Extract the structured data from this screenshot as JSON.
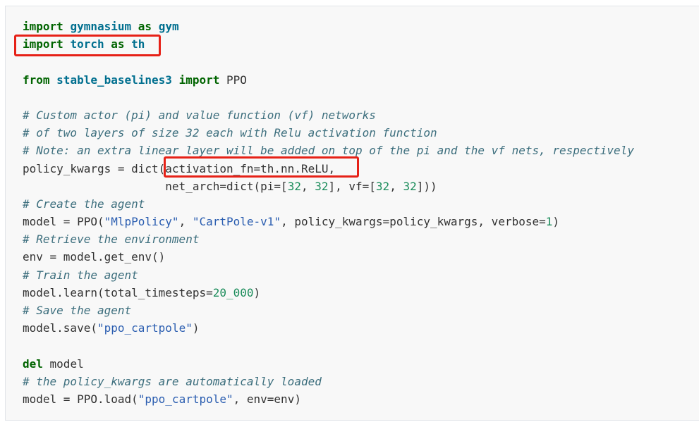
{
  "lines": [
    [
      {
        "t": "import",
        "c": "kw"
      },
      {
        "t": " "
      },
      {
        "t": "gymnasium",
        "c": "mod"
      },
      {
        "t": " "
      },
      {
        "t": "as",
        "c": "kw"
      },
      {
        "t": " "
      },
      {
        "t": "gym",
        "c": "mod"
      }
    ],
    [
      {
        "t": "import",
        "c": "kw"
      },
      {
        "t": " "
      },
      {
        "t": "torch",
        "c": "mod"
      },
      {
        "t": " "
      },
      {
        "t": "as",
        "c": "kw"
      },
      {
        "t": " "
      },
      {
        "t": "th",
        "c": "mod"
      }
    ],
    [],
    [
      {
        "t": "from",
        "c": "kw"
      },
      {
        "t": " "
      },
      {
        "t": "stable_baselines3",
        "c": "mod"
      },
      {
        "t": " "
      },
      {
        "t": "import",
        "c": "kw"
      },
      {
        "t": " PPO"
      }
    ],
    [],
    [
      {
        "t": "# Custom actor (pi) and value function (vf) networks",
        "c": "cm"
      }
    ],
    [
      {
        "t": "# of two layers of size 32 each with Relu activation function",
        "c": "cm"
      }
    ],
    [
      {
        "t": "# Note: an extra linear layer will be added on top of the pi and the vf nets, respectively",
        "c": "cm"
      }
    ],
    [
      {
        "t": "policy_kwargs = dict(activation_fn=th.nn.ReLU,"
      }
    ],
    [
      {
        "t": "                     net_arch=dict(pi=["
      },
      {
        "t": "32",
        "c": "num"
      },
      {
        "t": ", "
      },
      {
        "t": "32",
        "c": "num"
      },
      {
        "t": "], vf=["
      },
      {
        "t": "32",
        "c": "num"
      },
      {
        "t": ", "
      },
      {
        "t": "32",
        "c": "num"
      },
      {
        "t": "]))"
      }
    ],
    [
      {
        "t": "# Create the agent",
        "c": "cm"
      }
    ],
    [
      {
        "t": "model = PPO("
      },
      {
        "t": "\"MlpPolicy\"",
        "c": "str"
      },
      {
        "t": ", "
      },
      {
        "t": "\"CartPole-v1\"",
        "c": "str"
      },
      {
        "t": ", policy_kwargs=policy_kwargs, verbose="
      },
      {
        "t": "1",
        "c": "num"
      },
      {
        "t": ")"
      }
    ],
    [
      {
        "t": "# Retrieve the environment",
        "c": "cm"
      }
    ],
    [
      {
        "t": "env = model.get_env()"
      }
    ],
    [
      {
        "t": "# Train the agent",
        "c": "cm"
      }
    ],
    [
      {
        "t": "model.learn(total_timesteps="
      },
      {
        "t": "20_000",
        "c": "num"
      },
      {
        "t": ")"
      }
    ],
    [
      {
        "t": "# Save the agent",
        "c": "cm"
      }
    ],
    [
      {
        "t": "model.save("
      },
      {
        "t": "\"ppo_cartpole\"",
        "c": "str"
      },
      {
        "t": ")"
      }
    ],
    [],
    [
      {
        "t": "del",
        "c": "kw"
      },
      {
        "t": " model"
      }
    ],
    [
      {
        "t": "# the policy_kwargs are automatically loaded",
        "c": "cm"
      }
    ],
    [
      {
        "t": "model = PPO.load("
      },
      {
        "t": "\"ppo_cartpole\"",
        "c": "str"
      },
      {
        "t": ", env=env)"
      }
    ]
  ],
  "highlight_color": "#e62117"
}
